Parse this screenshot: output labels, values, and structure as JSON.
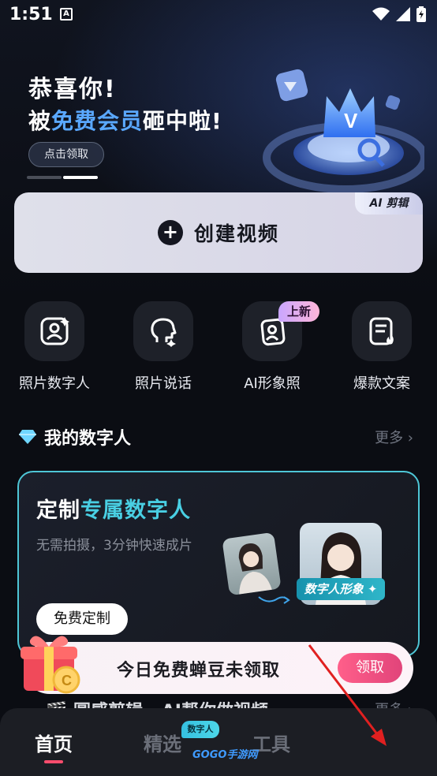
{
  "status_bar": {
    "time": "1:51",
    "notif_letter": "A"
  },
  "banner": {
    "line1": "恭喜你!",
    "line2_prefix": "被",
    "line2_highlight": "免费会员",
    "line2_suffix": "砸中啦!",
    "claim_label": "点击领取"
  },
  "create_card": {
    "label": "创建视频",
    "tag": "AI 剪辑"
  },
  "tools": [
    {
      "label": "照片数字人",
      "icon": "photo-avatar-icon"
    },
    {
      "label": "照片说话",
      "icon": "talking-head-icon"
    },
    {
      "label": "AI形象照",
      "icon": "ai-portrait-icon",
      "badge": "上新"
    },
    {
      "label": "爆款文案",
      "icon": "hot-copy-icon"
    }
  ],
  "my_digital_humans": {
    "title": "我的数字人",
    "more": "更多 ›",
    "card": {
      "title_prefix": "定制",
      "title_highlight": "专属数字人",
      "subtitle": "无需拍摄，3分钟快速成片",
      "button": "免费定制",
      "tag": "数字人形象 ✦"
    }
  },
  "coin_banner": {
    "text": "今日免费蝉豆未领取",
    "button": "领取"
  },
  "next_section": {
    "title": "🎬 圆感剪辑 · AI帮你做视频",
    "more": "更多 ›"
  },
  "tab_bar": {
    "home": "首页",
    "picks": "精选",
    "picks_badge": "数字人",
    "tools": "工具"
  },
  "watermark": "GOGO手游网",
  "colors": {
    "accent_blue": "#5aa8ff",
    "teal": "#49cfe3",
    "pink": "#ff4d6d"
  }
}
